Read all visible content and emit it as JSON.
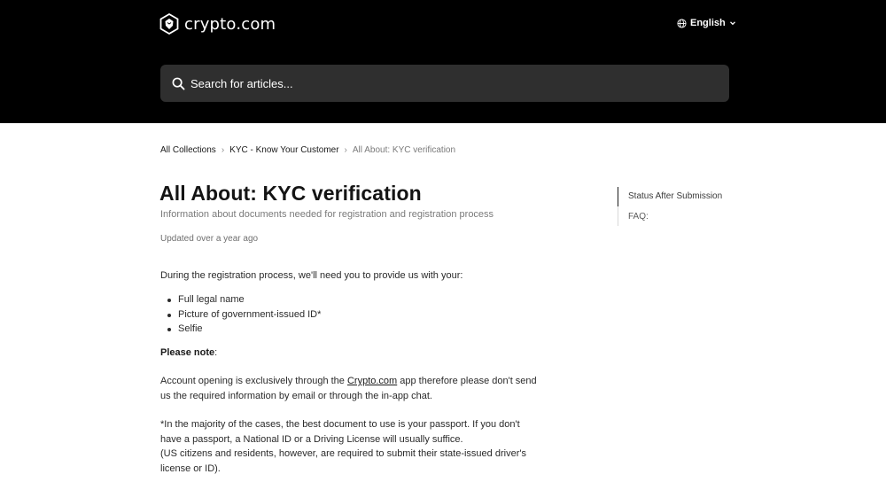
{
  "header": {
    "logo_text": "crypto.com",
    "language_label": "English",
    "bg_color": "#000000"
  },
  "search": {
    "placeholder": "Search for articles..."
  },
  "breadcrumb": {
    "items": [
      "All Collections",
      "KYC - Know Your Customer",
      "All About: KYC verification"
    ],
    "separator": "›"
  },
  "article": {
    "title": "All About: KYC verification",
    "subtitle": "Information about documents needed for registration and registration process",
    "updated": "Updated over a year ago",
    "intro": "During the registration process, we'll need you to provide us with your:",
    "bullets": [
      "Full legal name",
      "Picture of government-issued ID*",
      "Selfie"
    ],
    "note_label": "Please note",
    "note_colon": ":",
    "para1_before": "Account opening is exclusively through the ",
    "para1_link": "Crypto.com",
    "para1_after": " app therefore please don't send us the required information by email or through the in-app chat.",
    "para2_line1": "*In the majority of the cases, the best document to use is your passport.  If you don't have a passport, a National ID or a Driving License will usually suffice.",
    "para2_line2": "(US citizens and residents, however, are required to submit their state-issued driver's license or ID)."
  },
  "toc": {
    "items": [
      "Status After Submission",
      "FAQ:"
    ]
  },
  "icons": {
    "logo": "crypto-lion-shield-icon",
    "language": "globe-icon",
    "dropdown": "chevron-down-icon",
    "search": "search-icon"
  }
}
